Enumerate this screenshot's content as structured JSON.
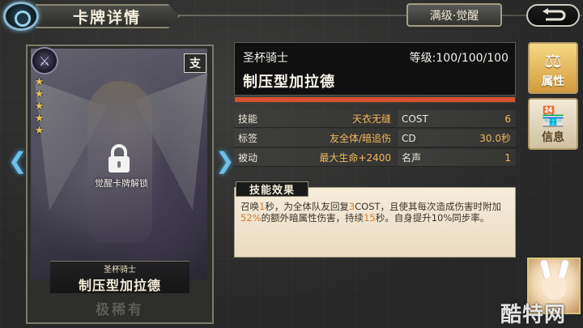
{
  "header": {
    "title": "卡牌详情",
    "level_button": "满级·觉醒"
  },
  "card": {
    "faction_badge": "支",
    "star_count": 5,
    "lock_label": "觉醒卡牌解锁",
    "type_small": "圣杯骑士",
    "name_big": "制压型加拉德",
    "rarity": "极稀有"
  },
  "info": {
    "type": "圣杯骑士",
    "level": "等级:100/100/100",
    "name": "制压型加拉德",
    "progress": 1.0,
    "progress_color": "#d8502f"
  },
  "stats": [
    {
      "key": "技能",
      "val": "天衣无缝",
      "key2": "COST",
      "val2": "6"
    },
    {
      "key": "标签",
      "val": "友全体/暗追伤",
      "key2": "CD",
      "val2": "30.0秒"
    },
    {
      "key": "被动",
      "val": "最大生命+2400",
      "key2": "名声",
      "val2": "1"
    }
  ],
  "skill": {
    "title": "技能效果",
    "desc_parts": [
      {
        "t": "召唤",
        "h": false
      },
      {
        "t": "1",
        "h": true
      },
      {
        "t": "秒，为全体队友回复",
        "h": false
      },
      {
        "t": "3",
        "h": true
      },
      {
        "t": "COST，且使其每次造成伤害时附加",
        "h": false
      },
      {
        "t": "52%",
        "h": true
      },
      {
        "t": "的额外暗属性伤害，持续",
        "h": false
      },
      {
        "t": "15",
        "h": true
      },
      {
        "t": "秒。自身提升10%同步率。",
        "h": false
      }
    ]
  },
  "tabs": {
    "attributes": "属性",
    "info": "信息"
  },
  "watermark": "酷特网",
  "colors": {
    "highlight": "#d67c2a",
    "stat_value": "#f0b85a"
  }
}
